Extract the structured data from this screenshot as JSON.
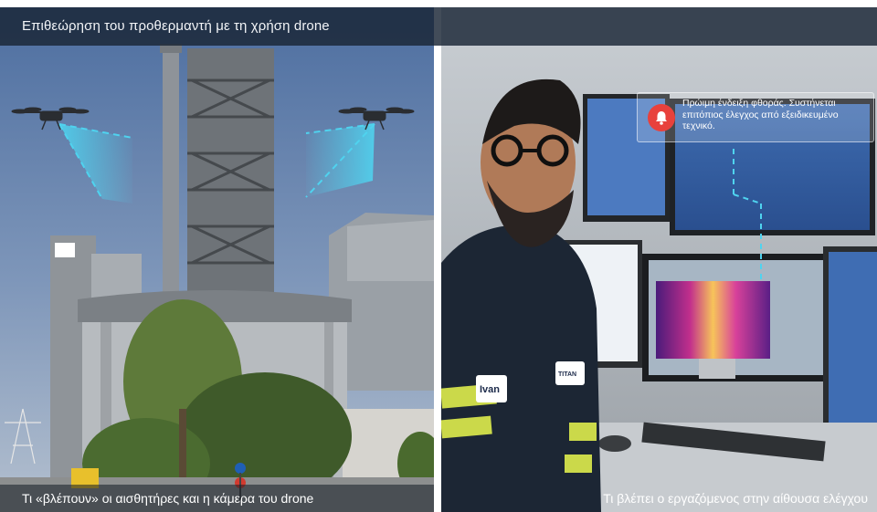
{
  "header": {
    "title": "Επιθεώρηση του προθερμαντή με τη χρήση drone"
  },
  "left_panel": {
    "caption": "Τι «βλέπουν» οι αισθητήρες και η κάμερα του drone"
  },
  "right_panel": {
    "caption": "Τι βλέπει ο εργαζόμενος στην αίθουσα ελέγχου",
    "alert": {
      "text": "Πρώιμη ένδειξη φθοράς. Συστήνεται επιτόπιος έλεγχος από εξειδικευμένο τεχνικό.",
      "icon": "bell-icon",
      "accent_color": "#e8413c"
    },
    "badge_name": "Ivan",
    "badge_logo": "TITAN"
  },
  "colors": {
    "banner_bg": "#182434",
    "scan_beam": "#4fd3ef"
  }
}
